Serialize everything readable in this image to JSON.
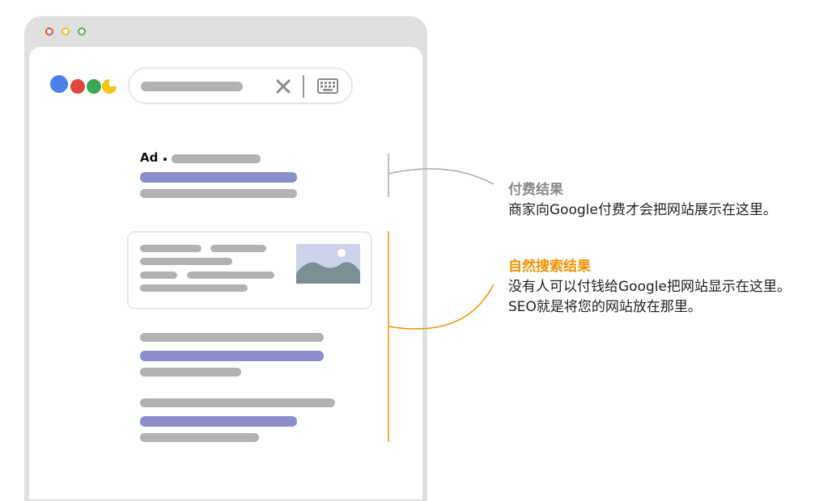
{
  "window": {
    "dots": [
      {
        "name": "close",
        "color": "#e0483f"
      },
      {
        "name": "minimize",
        "color": "#f2b924"
      },
      {
        "name": "maximize",
        "color": "#4caf50"
      }
    ]
  },
  "logo": {
    "colors": [
      "#4a81e6",
      "#e0483f",
      "#37a853",
      "#f7c419"
    ]
  },
  "search": {
    "clear_icon": "close-icon",
    "keyboard_icon": "keyboard-icon"
  },
  "ad_result": {
    "badge": "Ad"
  },
  "annotations": {
    "paid": {
      "title": "付费结果",
      "title_color": "#888888",
      "line1": "商家向Google付费才会把网站展示在这里。"
    },
    "organic": {
      "title": "自然搜索结果",
      "title_color": "#f29100",
      "line1": "没有人可以付钱给Google把网站显示在这里。",
      "line2": "SEO就是将您的网站放在那里。"
    }
  },
  "colors": {
    "link_bar": "#8a8fcb",
    "text_bar": "#b2b2b2",
    "paid_line": "#aaaaaa",
    "organic_line": "#f29100"
  }
}
